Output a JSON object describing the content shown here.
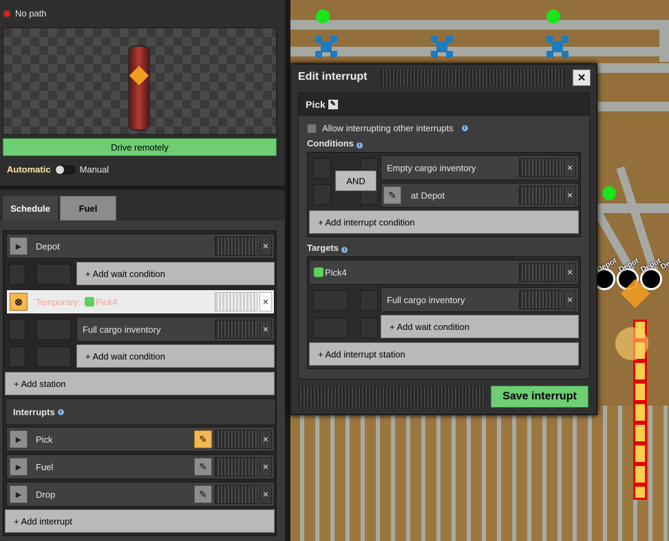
{
  "status": {
    "text": "No path"
  },
  "controls": {
    "drive_remotely": "Drive remotely",
    "automatic": "Automatic",
    "manual": "Manual"
  },
  "tabs": [
    {
      "label": "Schedule",
      "active": true
    },
    {
      "label": "Fuel",
      "active": false
    }
  ],
  "schedule": {
    "station1": "Depot",
    "add_wait1": "+ Add wait condition",
    "temporary_prefix": "Temporary:",
    "temporary_station": "Pick4",
    "condition2": "Full cargo inventory",
    "add_wait2": "+ Add wait condition",
    "add_station": "+ Add station"
  },
  "interrupts": {
    "header": "Interrupts",
    "items": [
      {
        "label": "Pick"
      },
      {
        "label": "Fuel"
      },
      {
        "label": "Drop"
      }
    ],
    "add_interrupt": "+ Add interrupt"
  },
  "map": {
    "depot_labels": [
      "Depot",
      "Depot",
      "Depot",
      "De"
    ]
  },
  "dialog": {
    "title": "Edit interrupt",
    "name": "Pick",
    "allow_interrupting": "Allow interrupting other interrupts",
    "conditions_label": "Conditions",
    "and_label": "AND",
    "condition1": "Empty cargo inventory",
    "condition2": "at Depot",
    "add_condition": "+ Add interrupt condition",
    "targets_label": "Targets",
    "target_station": "Pick4",
    "target_condition": "Full cargo inventory",
    "add_wait": "+ Add wait condition",
    "add_station": "+ Add interrupt station",
    "save": "Save interrupt"
  },
  "icons": {
    "close": "close-icon",
    "play": "play-icon",
    "pencil": "pencil-icon",
    "info": "info-icon",
    "cargo": "cargo-icon"
  }
}
